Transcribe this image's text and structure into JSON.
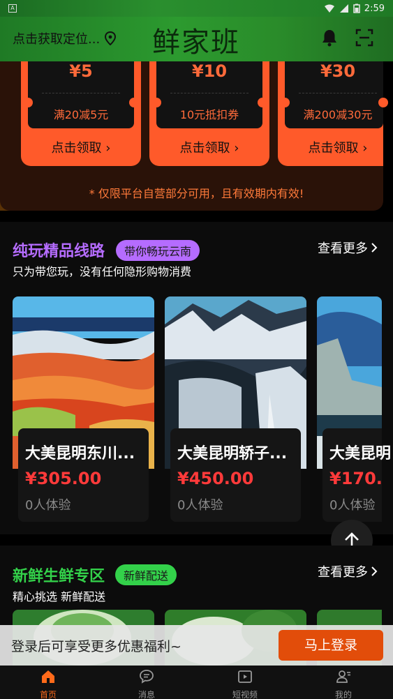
{
  "status_bar": {
    "time": "2:59"
  },
  "header": {
    "location_text": "点击获取定位...",
    "brand": "鲜家班"
  },
  "coupons": [
    {
      "amount": "¥5",
      "condition": "满20减5元",
      "button": "点击领取 ›"
    },
    {
      "amount": "¥10",
      "condition": "10元抵扣券",
      "button": "点击领取 ›"
    },
    {
      "amount": "¥30",
      "condition": "满200减30元",
      "button": "点击领取 ›"
    }
  ],
  "coupon_note": "* 仅限平台自营部分可用，且有效期内有效!",
  "tour_section": {
    "title": "纯玩精品线路",
    "badge": "带你畅玩云南",
    "subtitle": "只为带您玩，没有任何隐形购物消费",
    "more": "查看更多",
    "cards": [
      {
        "name": "大美昆明东川...",
        "price": "¥305.00",
        "experience": "0人体验"
      },
      {
        "name": "大美昆明轿子...",
        "price": "¥450.00",
        "experience": "0人体验"
      },
      {
        "name": "大美昆明",
        "price": "¥170.",
        "experience": "0人体验"
      }
    ]
  },
  "fresh_section": {
    "title": "新鲜生鲜专区",
    "badge": "新鲜配送",
    "subtitle": "精心挑选 新鲜配送",
    "more": "查看更多"
  },
  "login_bar": {
    "text": "登录后可享受更多优惠福利~",
    "button": "马上登录"
  },
  "tabbar": {
    "items": [
      {
        "label": "首页",
        "icon": "home-icon",
        "active": true
      },
      {
        "label": "消息",
        "icon": "message-icon",
        "active": false
      },
      {
        "label": "短视频",
        "icon": "video-icon",
        "active": false
      },
      {
        "label": "我的",
        "icon": "profile-icon",
        "active": false
      }
    ]
  },
  "colors": {
    "accent_orange": "#ff5a2a",
    "tour_title_purple": "#b56cff",
    "fresh_title_green": "#33d14a",
    "price_red": "#ff3a3a",
    "login_button": "#e24d0a"
  }
}
